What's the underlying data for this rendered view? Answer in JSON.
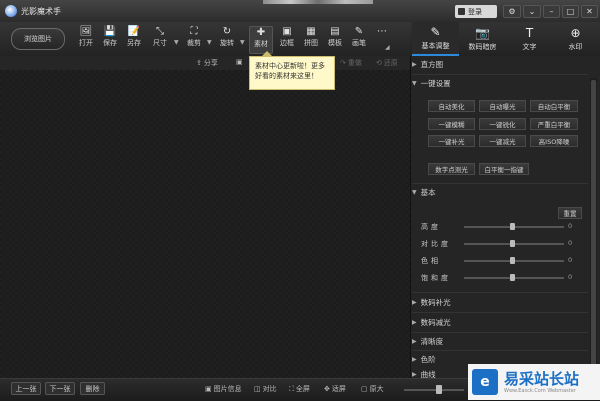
{
  "window": {
    "title": "光影魔术手",
    "login_label": "登录",
    "controls": [
      "⚙",
      "⌄",
      "–",
      "□",
      "✕"
    ]
  },
  "toolbar": {
    "browse_label": "浏览图片",
    "tools": [
      {
        "label": "打开",
        "icon": "🖼"
      },
      {
        "label": "保存",
        "icon": "💾"
      },
      {
        "label": "另存",
        "icon": "📝"
      },
      {
        "label": "尺寸",
        "icon": "⤡"
      },
      {
        "label": "裁剪",
        "icon": "⛶"
      },
      {
        "label": "旋转",
        "icon": "↻"
      },
      {
        "label": "素材",
        "icon": "✚"
      },
      {
        "label": "边框",
        "icon": "▣"
      },
      {
        "label": "拼图",
        "icon": "▦"
      },
      {
        "label": "模板",
        "icon": "▤"
      },
      {
        "label": "画笔",
        "icon": "✎"
      },
      {
        "label": "",
        "icon": "⋯"
      }
    ]
  },
  "right_tabs": [
    {
      "label": "基本调整",
      "icon": "✎"
    },
    {
      "label": "数码暗房",
      "icon": "📷"
    },
    {
      "label": "文字",
      "icon": "T"
    },
    {
      "label": "水印",
      "icon": "⊕"
    }
  ],
  "subbar": {
    "share_label": "分享",
    "redo_label": "重做",
    "restore_label": "还原"
  },
  "tooltip": {
    "line1": "素材中心更新啦！更多",
    "line2": "好看的素材来这里！"
  },
  "panel": {
    "histogram": "直方图",
    "one_click": "一键设置",
    "one_click_buttons": [
      [
        "自动美化",
        "自动曝光",
        "自动白平衡"
      ],
      [
        "一键模糊",
        "一键锐化",
        "严重白平衡"
      ],
      [
        "一键补光",
        "一键减光",
        "高ISO降噪"
      ]
    ],
    "extra_buttons": [
      "数字点测光",
      "白平衡一指键"
    ],
    "basic": "基本",
    "reset_label": "重置",
    "sliders": [
      {
        "label": "高度",
        "value": 0
      },
      {
        "label": "对比度",
        "value": 0
      },
      {
        "label": "色相",
        "value": 0
      },
      {
        "label": "饱和度",
        "value": 0
      }
    ],
    "sections": [
      "数码补光",
      "数码减光",
      "清晰度",
      "色阶",
      "曲线"
    ]
  },
  "bottombar": {
    "prev_label": "上一张",
    "next_label": "下一张",
    "delete_label": "删除",
    "info_label": "图片信息",
    "compare_label": "对比",
    "fullscreen_label": "全屏",
    "fit_label": "适屏",
    "original_label": "原大"
  },
  "watermark": {
    "title": "易采站长站",
    "url": "Www.Easck.Com  Webmaster"
  }
}
